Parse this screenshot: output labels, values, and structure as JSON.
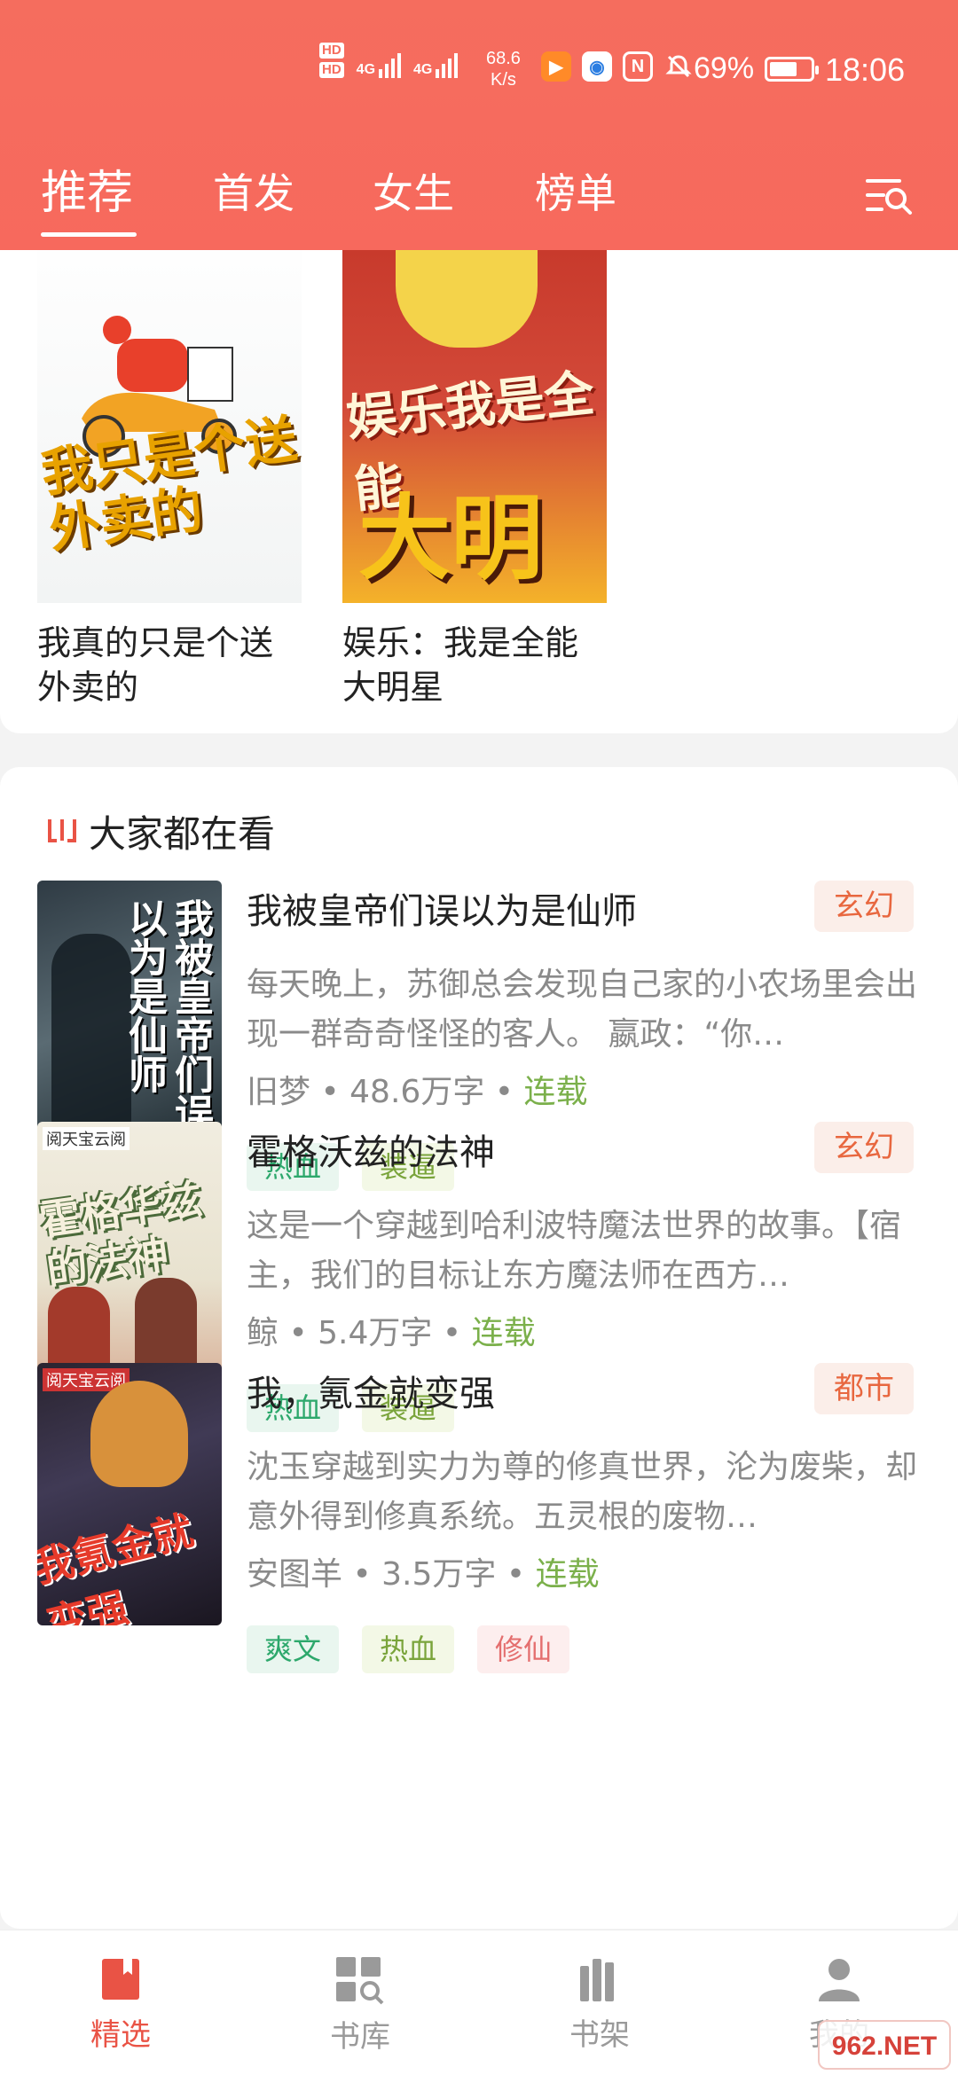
{
  "status_bar": {
    "network_label_1": "HD",
    "network_label_2": "HD",
    "signal_1": "4G",
    "signal_2": "4G",
    "speed_value": "68.6",
    "speed_unit": "K/s",
    "nfc_label": "N",
    "battery_text": "69%",
    "battery_level_percent": 69,
    "time": "18:06"
  },
  "tabs": [
    {
      "label": "推荐",
      "active": true
    },
    {
      "label": "首发",
      "active": false
    },
    {
      "label": "女生",
      "active": false
    },
    {
      "label": "榜单",
      "active": false
    }
  ],
  "featured_books": [
    {
      "title": "我真的只是个送外卖的",
      "cover_text": "我只是个送外卖的"
    },
    {
      "title": "娱乐：我是全能大明星",
      "cover_text_top": "娱乐我是全能",
      "cover_text_main": "大明星"
    }
  ],
  "section": {
    "title": "大家都在看",
    "books": [
      {
        "title": "我被皇帝们误以为是仙师",
        "genre": "玄幻",
        "desc": "每天晚上，苏御总会发现自己家的小农场里会出现一群奇奇怪怪的客人。 嬴政：“你…",
        "author": "旧梦",
        "words": "48.6万字",
        "status": "连载",
        "cover_text": "我被皇帝们误以为是仙师",
        "tags": [
          {
            "label": "热血",
            "style": "green"
          },
          {
            "label": "装逼",
            "style": "lime"
          }
        ]
      },
      {
        "title": "霍格沃兹的法神",
        "genre": "玄幻",
        "desc": "这是一个穿越到哈利波特魔法世界的故事。【宿主，我们的目标让东方魔法师在西方…",
        "author": "鲸",
        "words": "5.4万字",
        "status": "连载",
        "cover_brand": "阅天宝云阅",
        "cover_text": "霍格华兹的法神",
        "tags": [
          {
            "label": "热血",
            "style": "green"
          },
          {
            "label": "装逼",
            "style": "lime"
          }
        ]
      },
      {
        "title": "我，氪金就变强",
        "genre": "都市",
        "desc": "沈玉穿越到实力为尊的修真世界，沦为废柴，却意外得到修真系统。五灵根的废物…",
        "author": "安图羊",
        "words": "3.5万字",
        "status": "连载",
        "cover_brand": "阅天宝云阅",
        "cover_text": "我氪金就变强",
        "tags": [
          {
            "label": "爽文",
            "style": "green"
          },
          {
            "label": "热血",
            "style": "lime"
          },
          {
            "label": "修仙",
            "style": "pink"
          }
        ]
      }
    ]
  },
  "meta_separator": "•",
  "bottom_nav": [
    {
      "label": "精选",
      "icon": "bookmark-book-icon",
      "active": true
    },
    {
      "label": "书库",
      "icon": "library-search-icon",
      "active": false
    },
    {
      "label": "书架",
      "icon": "bookshelf-icon",
      "active": false
    },
    {
      "label": "我的",
      "icon": "user-icon",
      "active": false
    }
  ],
  "watermark": "962.NET",
  "colors": {
    "header": "#f56d5e",
    "accent": "#e95345",
    "genre_text": "#e8673f",
    "status_text": "#7bb04b"
  }
}
